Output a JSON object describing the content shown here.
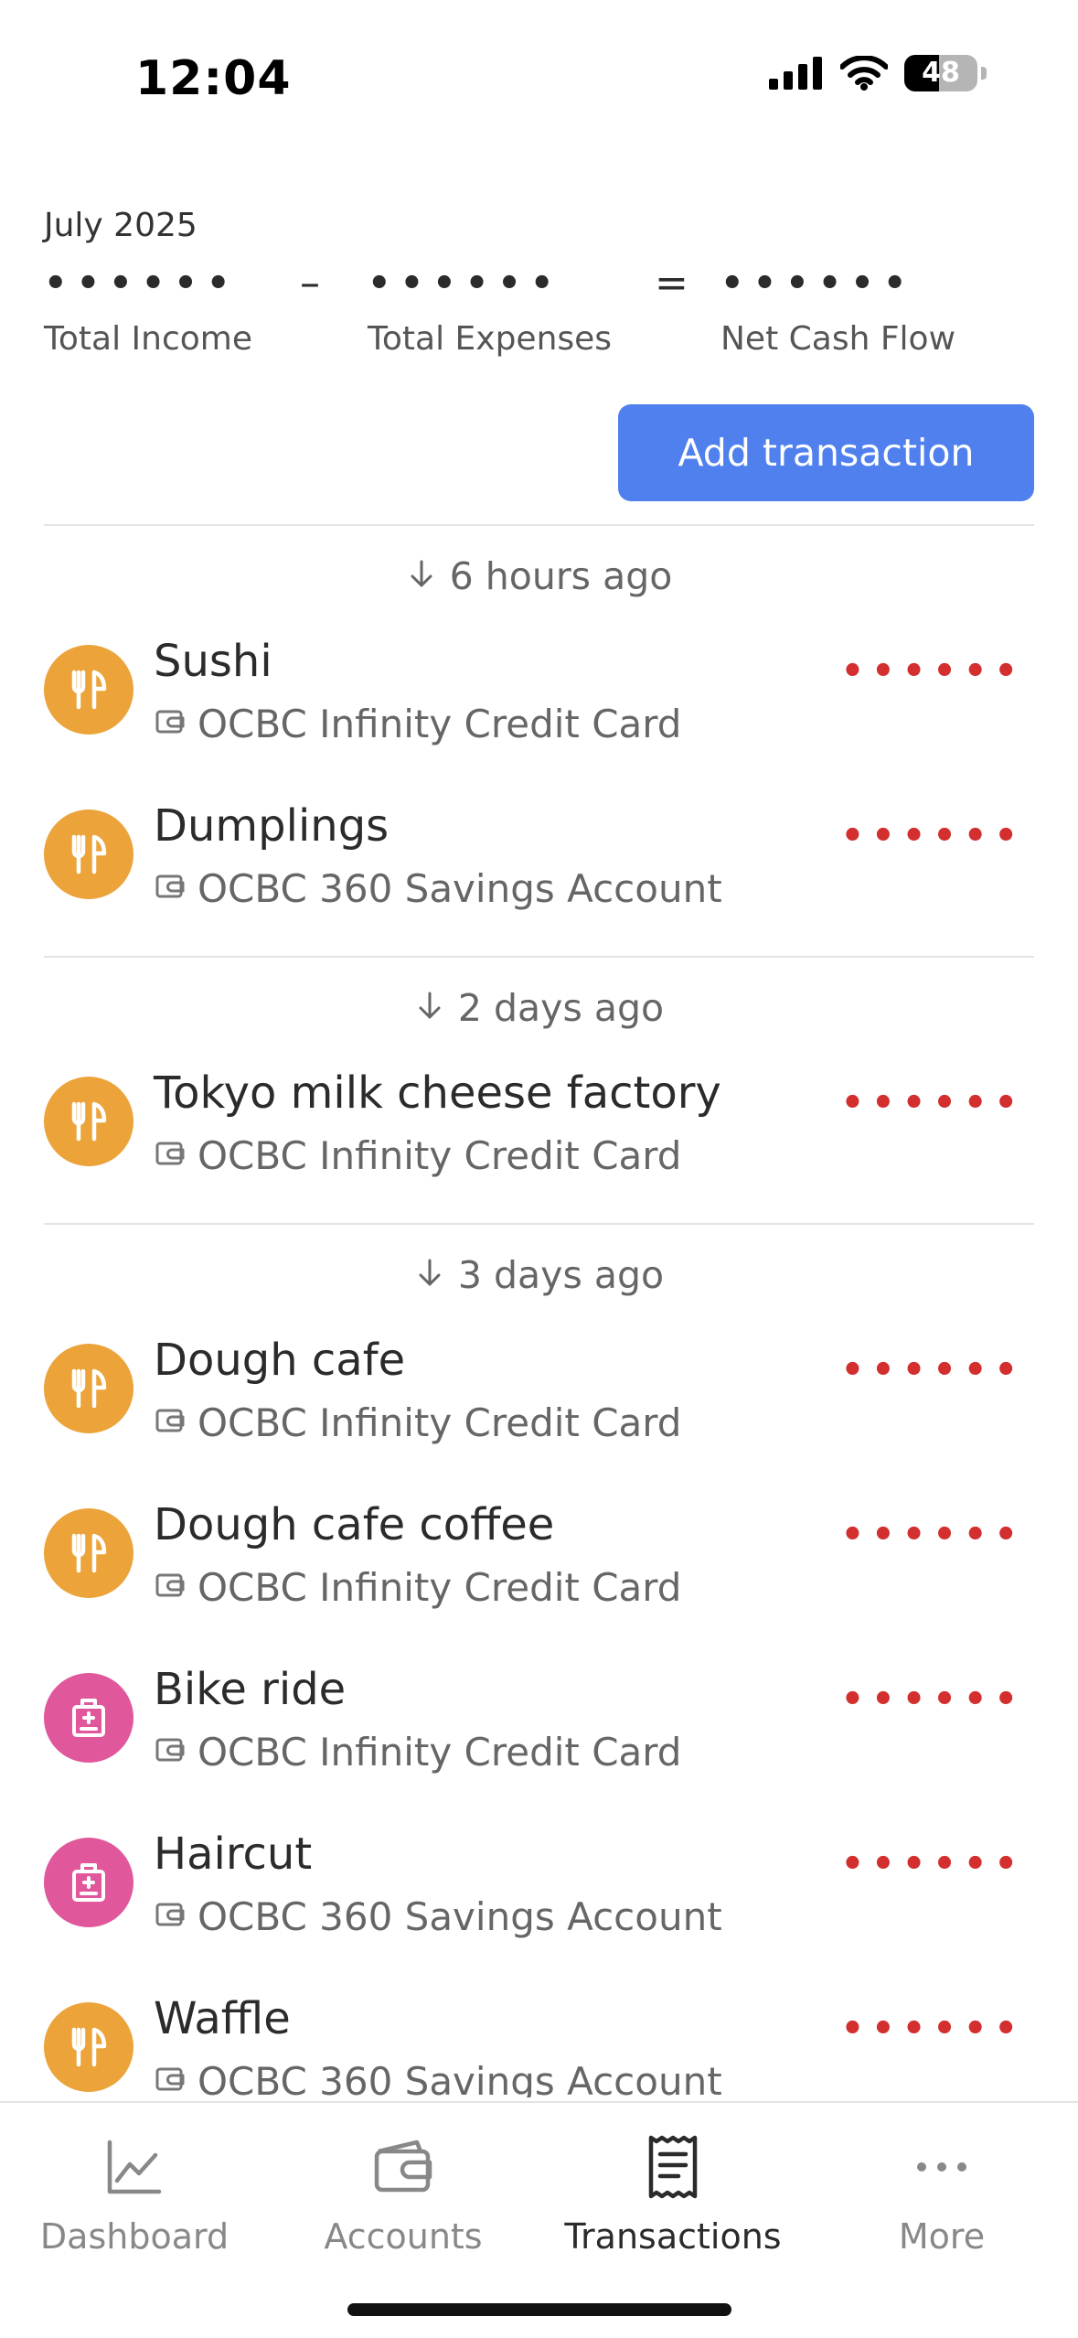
{
  "status_bar": {
    "time": "12:04",
    "battery": "48"
  },
  "summary": {
    "month": "July 2025",
    "income_masked": "••••••",
    "expenses_masked": "••••••",
    "net_masked": "••••••",
    "minus": "–",
    "equals": "=",
    "income_label": "Total Income",
    "expenses_label": "Total Expenses",
    "net_label": "Net Cash Flow"
  },
  "add_button": "Add transaction",
  "groups": [
    {
      "header": "6 hours ago",
      "items": [
        {
          "name": "Sushi",
          "account": "OCBC Infinity Credit Card",
          "amount": "••••••",
          "category": "food"
        },
        {
          "name": "Dumplings",
          "account": "OCBC 360 Savings Account",
          "amount": "••••••",
          "category": "food"
        }
      ]
    },
    {
      "header": "2 days ago",
      "items": [
        {
          "name": "Tokyo milk cheese factory",
          "account": "OCBC Infinity Credit Card",
          "amount": "••••••",
          "category": "food"
        }
      ]
    },
    {
      "header": "3 days ago",
      "items": [
        {
          "name": "Dough cafe",
          "account": "OCBC Infinity Credit Card",
          "amount": "••••••",
          "category": "food"
        },
        {
          "name": "Dough cafe coffee",
          "account": "OCBC Infinity Credit Card",
          "amount": "••••••",
          "category": "food"
        },
        {
          "name": "Bike ride",
          "account": "OCBC Infinity Credit Card",
          "amount": "••••••",
          "category": "health"
        },
        {
          "name": "Haircut",
          "account": "OCBC 360 Savings Account",
          "amount": "••••••",
          "category": "health"
        },
        {
          "name": "Waffle",
          "account": "OCBC 360 Savings Account",
          "amount": "••••••",
          "category": "food"
        }
      ]
    }
  ],
  "tabs": [
    {
      "label": "Dashboard",
      "icon": "chart-line-icon"
    },
    {
      "label": "Accounts",
      "icon": "wallet-icon"
    },
    {
      "label": "Transactions",
      "icon": "receipt-icon"
    },
    {
      "label": "More",
      "icon": "more-dots-icon"
    }
  ],
  "active_tab": "Transactions",
  "colors": {
    "accent": "#4f80ee",
    "expense": "#d32f2f",
    "food_category": "#eba33a",
    "health_category": "#e0579b"
  }
}
